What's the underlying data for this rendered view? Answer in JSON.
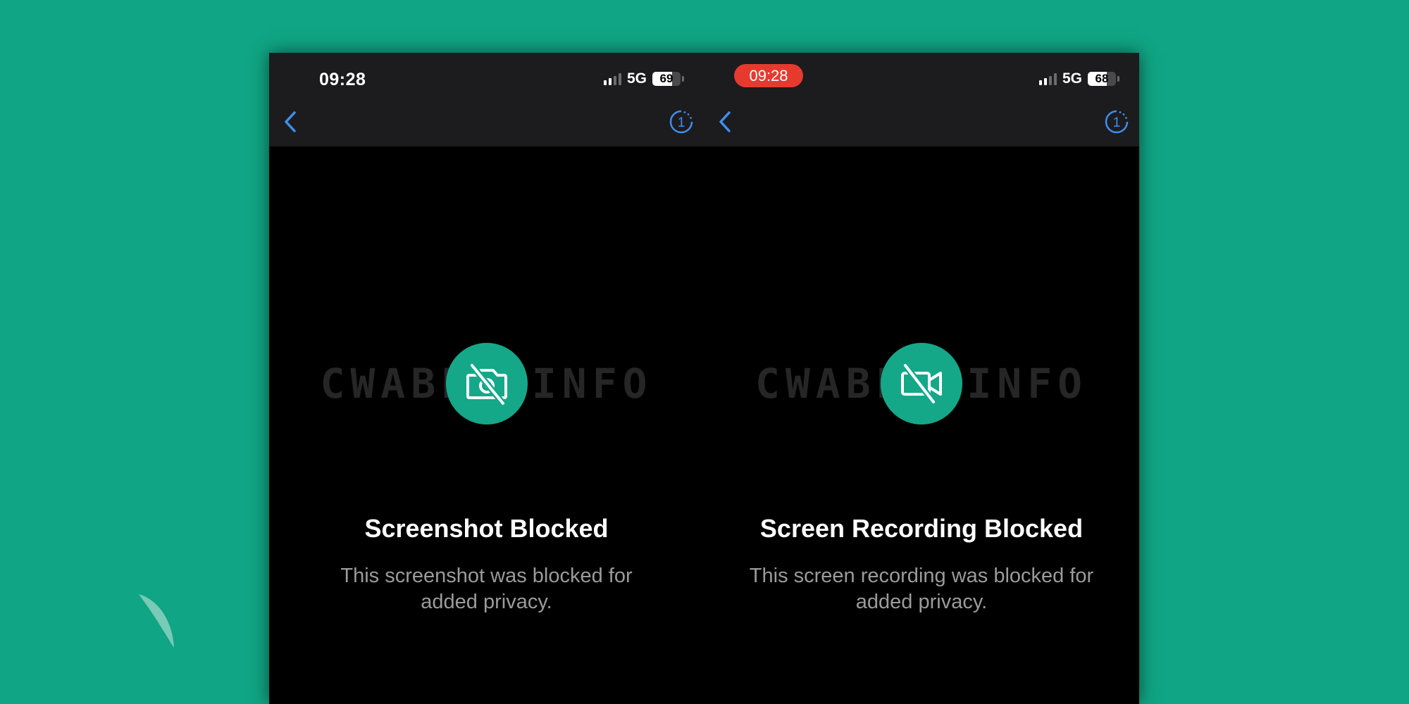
{
  "panels": [
    {
      "status": {
        "time": "09:28",
        "network": "5G",
        "battery": "69",
        "battery_level": 0.69,
        "recording": false
      },
      "watermark": "CWABETAINFO",
      "icon": "camera-off-icon",
      "title": "Screenshot Blocked",
      "description": "This screenshot was blocked for added privacy."
    },
    {
      "status": {
        "time": "09:28",
        "network": "5G",
        "battery": "68",
        "battery_level": 0.68,
        "recording": true
      },
      "watermark": "CWABETAINFO",
      "icon": "video-off-icon",
      "title": "Screen Recording Blocked",
      "description": "This screen recording was blocked for added privacy."
    }
  ],
  "colors": {
    "background": "#10a584",
    "accent": "#14a889",
    "ios_blue": "#3f8ef0",
    "recording_red": "#e63a2f"
  },
  "nav": {
    "timer_value": "1"
  }
}
